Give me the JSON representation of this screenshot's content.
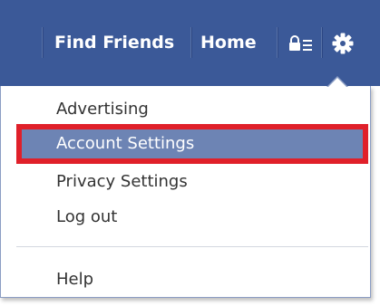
{
  "topbar": {
    "nav_links": [
      "Find Friends",
      "Home"
    ],
    "privacy_icon": "privacy-shortcuts-icon",
    "settings_icon": "gear-icon",
    "background": "#3b5998"
  },
  "menu": {
    "items": [
      {
        "label": "Advertising"
      },
      {
        "label": "Account Settings",
        "highlighted": true
      },
      {
        "label": "Privacy Settings"
      },
      {
        "label": "Log out"
      },
      {
        "label": "Help"
      }
    ],
    "highlight_color": "#6d84b4",
    "callout_color": "#e0202a"
  }
}
